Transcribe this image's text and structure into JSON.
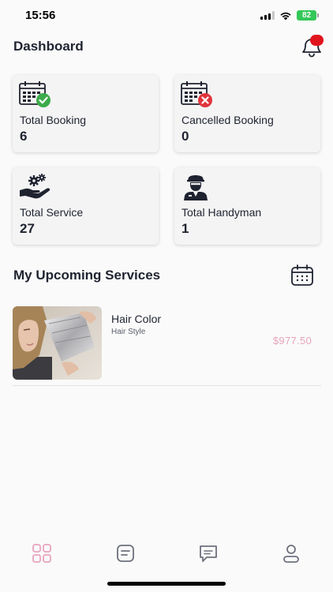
{
  "status_bar": {
    "time": "15:56",
    "battery": "82"
  },
  "header": {
    "title": "Dashboard"
  },
  "stats": [
    {
      "label": "Total Booking",
      "value": "6",
      "icon": "calendar-check-icon"
    },
    {
      "label": "Cancelled Booking",
      "value": "0",
      "icon": "calendar-cancel-icon"
    },
    {
      "label": "Total Service",
      "value": "27",
      "icon": "service-hand-gears-icon"
    },
    {
      "label": "Total Handyman",
      "value": "1",
      "icon": "handyman-icon"
    }
  ],
  "upcoming": {
    "title": "My Upcoming Services",
    "items": [
      {
        "name": "Hair Color",
        "category": "Hair Style",
        "price": "$977.50"
      }
    ]
  },
  "bottom_nav": [
    {
      "icon": "dashboard-grid-icon",
      "active": true
    },
    {
      "icon": "bookings-list-icon",
      "active": false
    },
    {
      "icon": "chat-icon",
      "active": false
    },
    {
      "icon": "profile-icon",
      "active": false
    }
  ],
  "colors": {
    "accent_pink": "#e8a4bd",
    "check_green": "#3cab4a",
    "cancel_red": "#e0343c",
    "badge_red": "#e0141c",
    "battery_green": "#34c759"
  }
}
